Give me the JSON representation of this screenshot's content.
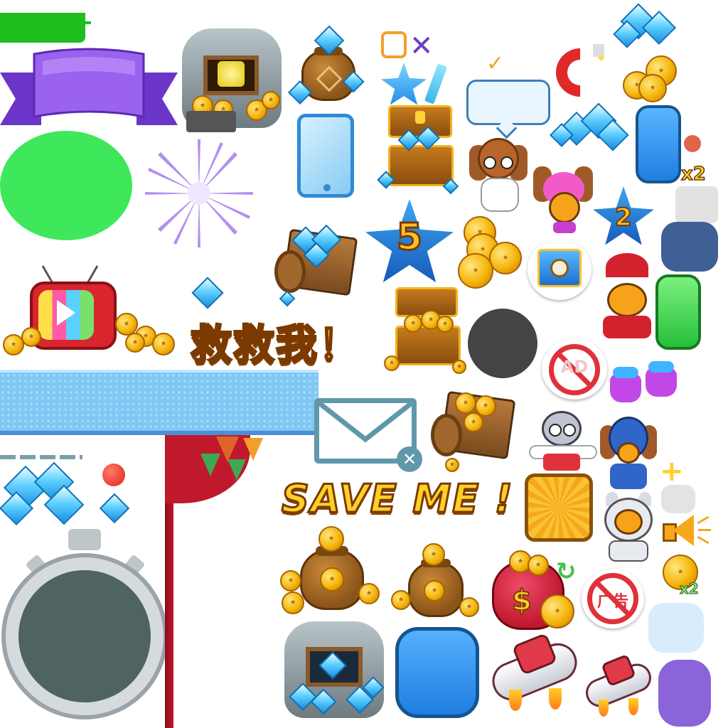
{
  "texts": {
    "save_me_cn": "救救我！",
    "save_me_en": "SAVE ME !",
    "star_level_5": "5",
    "star_level_2": "2",
    "multiplier_x2_a": "x2",
    "multiplier_x2_b": "x2",
    "ad_label": "AD",
    "cn_ban_label": "广告",
    "dollar_sign": "$",
    "plus_sign": "+"
  },
  "colors": {
    "green_bar": "#1fbe1f",
    "green_circle": "#3ee85a",
    "purple_ribbon": "#8a4fe0",
    "blue_panel": "#7fc8f4",
    "red_curtain": "#c0182c",
    "orange_tile": "#f6b01e",
    "blue_button": "#2d9bf0",
    "green_button": "#33d04a",
    "purple_button": "#8a64d8",
    "dark_circle": "#444444",
    "light_blue_button": "#d8ecfc"
  },
  "icons": [
    "gold-mine-icon",
    "diamond-bag-icon",
    "blue-star-icon",
    "pencil-icon",
    "checkmark-icon",
    "speech-bubble-icon",
    "magnet-icon",
    "coin-stack-icon",
    "ice-crystal-icon",
    "phone-icon",
    "diamond-chest-icon",
    "aviator-character-icon",
    "pink-hair-character-icon",
    "diamond-cart-icon",
    "level-star-icon",
    "coin-pile-icon",
    "clock-chest-icon",
    "santa-character-icon",
    "tv-ad-icon",
    "gem-icon",
    "gold-chest-icon",
    "no-ad-icon",
    "jump-boots-icon",
    "mail-error-icon",
    "gold-cart-icon",
    "clown-character-icon",
    "robot-character-icon",
    "astronaut-character-icon",
    "megaphone-icon",
    "stopwatch-icon",
    "curtain-icon",
    "coin-bag-icon",
    "money-bag-icon",
    "no-cn-icon",
    "jet-ship-icon",
    "diamond-mine-icon"
  ]
}
